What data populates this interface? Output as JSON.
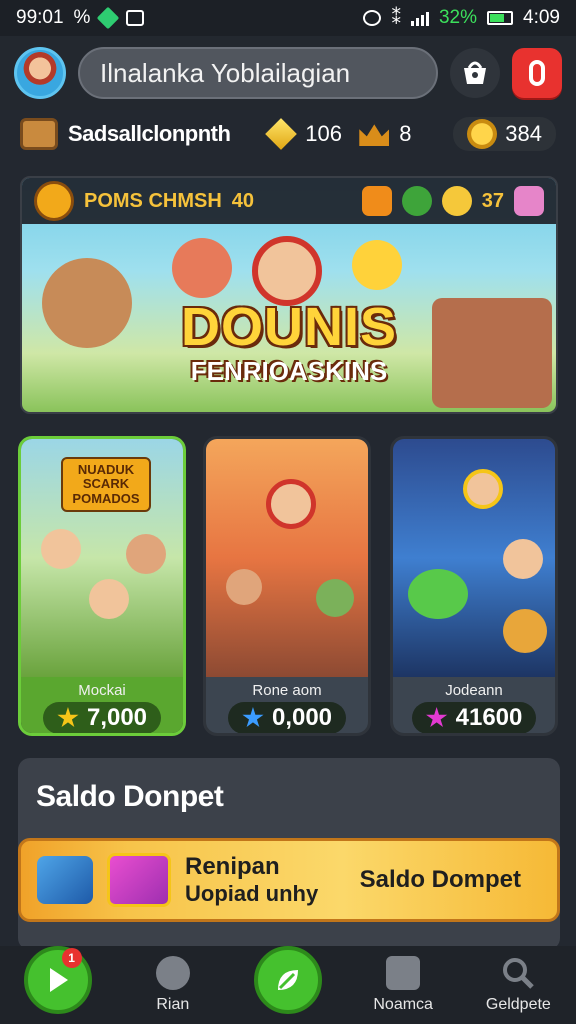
{
  "status_bar": {
    "time": "99:01",
    "percent": "%",
    "battery": "32%",
    "clock": "4:09"
  },
  "header": {
    "search_text": "Ilnalanka Yoblailagian"
  },
  "currency": {
    "name": "Sadsallclonpnth",
    "gems": "106",
    "crowns": "8",
    "coins": "384"
  },
  "hero": {
    "badge_label": "POMS CHMSH",
    "badge_count": "40",
    "count_2": "37",
    "title": "DOUNIS",
    "subtitle": "FENRIOASKINS"
  },
  "cards": [
    {
      "logo": "NUADUK SCARK POMADOS",
      "title": "Mockai",
      "price": "7,000",
      "star_color": "#f5c518"
    },
    {
      "logo": "",
      "title": "Rone aom",
      "price": "0,000",
      "star_color": "#3b9cff"
    },
    {
      "logo": "",
      "title": "Jodeann",
      "price": "41600",
      "star_color": "#e33ad1"
    }
  ],
  "wallet": {
    "title": "Saldo Donpet",
    "banner_line1": "Renipan",
    "banner_line2": "Uopiad unhy",
    "banner_right": "Saldo Dompet"
  },
  "nav": {
    "items": [
      {
        "label": ""
      },
      {
        "label": "Rian"
      },
      {
        "label": ""
      },
      {
        "label": "Noamca"
      },
      {
        "label": "Geldpete"
      }
    ],
    "badge": "1"
  }
}
